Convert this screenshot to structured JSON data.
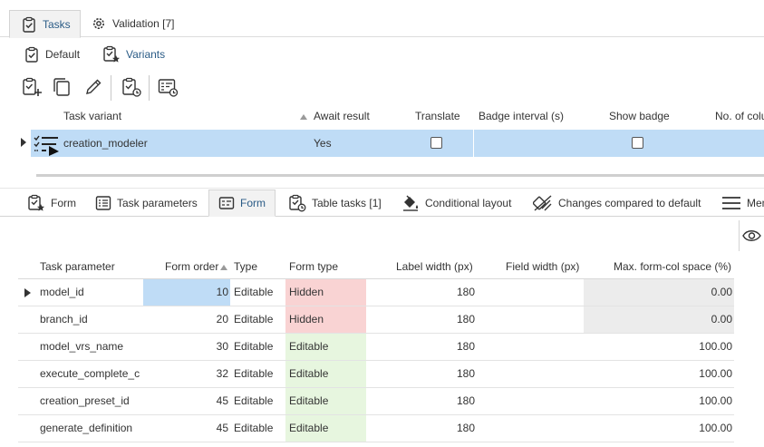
{
  "top_tabs": [
    {
      "label": "Tasks",
      "icon": "clipboard-check-icon",
      "active": true
    },
    {
      "label": "Validation [7]",
      "icon": "gear-icon",
      "active": false
    }
  ],
  "sub_tabs": [
    {
      "label": "Default",
      "icon": "clipboard-check-icon"
    },
    {
      "label": "Variants",
      "icon": "clipboard-star-icon"
    }
  ],
  "toolbar": {
    "icons": [
      "add-task-icon",
      "copy-icon",
      "edit-pencil-icon",
      "task-refresh-icon",
      "form-refresh-icon"
    ]
  },
  "upper_grid": {
    "columns": [
      "Task variant",
      "Await result",
      "Translate",
      "Badge interval (s)",
      "Show badge",
      "No. of colu"
    ],
    "row": {
      "task_variant": "creation_modeler",
      "await_result": "Yes",
      "translate": false,
      "badge_interval": "",
      "show_badge": false
    }
  },
  "lower_tabs": [
    {
      "label": "Form",
      "icon": "clipboard-star-icon",
      "active": false
    },
    {
      "label": "Task parameters",
      "icon": "list-icon",
      "active": false
    },
    {
      "label": "Form",
      "icon": "form-icon",
      "active": true
    },
    {
      "label": "Table tasks [1]",
      "icon": "task-refresh-icon",
      "active": false
    },
    {
      "label": "Conditional layout",
      "icon": "paint-bucket-icon",
      "active": false
    },
    {
      "label": "Changes compared to default",
      "icon": "compare-icon",
      "active": false
    },
    {
      "label": "Men",
      "icon": "menu-icon",
      "active": false
    }
  ],
  "lower_grid": {
    "columns": [
      "Task parameter",
      "Form order",
      "Type",
      "Form type",
      "Label width (px)",
      "Field width (px)",
      "Max. form-col space (%)"
    ],
    "rows": [
      {
        "param": "model_id",
        "order": "10",
        "type": "Editable",
        "form_type": "Hidden",
        "label_width": "180",
        "field_width": "",
        "max_space": "0.00"
      },
      {
        "param": "branch_id",
        "order": "20",
        "type": "Editable",
        "form_type": "Hidden",
        "label_width": "180",
        "field_width": "",
        "max_space": "0.00"
      },
      {
        "param": "model_vrs_name",
        "order": "30",
        "type": "Editable",
        "form_type": "Editable",
        "label_width": "180",
        "field_width": "",
        "max_space": "100.00"
      },
      {
        "param": "execute_complete_c",
        "order": "32",
        "type": "Editable",
        "form_type": "Editable",
        "label_width": "180",
        "field_width": "",
        "max_space": "100.00"
      },
      {
        "param": "creation_preset_id",
        "order": "45",
        "type": "Editable",
        "form_type": "Editable",
        "label_width": "180",
        "field_width": "",
        "max_space": "100.00"
      },
      {
        "param": "generate_definition",
        "order": "45",
        "type": "Editable",
        "form_type": "Editable",
        "label_width": "180",
        "field_width": "",
        "max_space": "100.00"
      }
    ]
  },
  "colors": {
    "selected_row": "#bfdcf6",
    "hidden_cell": "#f9d3d3",
    "editable_cell": "#e7f6df",
    "accent": "#2a5b86"
  }
}
